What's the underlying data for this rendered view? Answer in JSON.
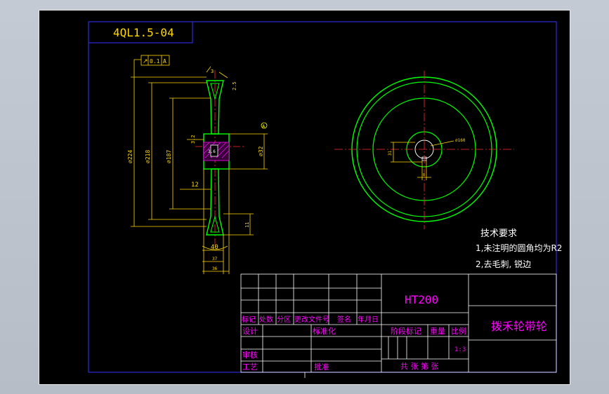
{
  "drawing": {
    "code": "4QL1.5-04",
    "tolerance_frame": {
      "symbol": "↗",
      "value": "0.1",
      "datum": "A"
    },
    "datum_marker": "A",
    "dims": {
      "d224": "⌀224",
      "d218": "⌀218",
      "d187": "⌀187",
      "d32": "⌀32",
      "r05": "3.2",
      "bore": "3.6",
      "angle": "3",
      "chamfer": "2.5",
      "hub_len": "12",
      "groove": "11",
      "w40": "40",
      "w37": "37",
      "w36": "36",
      "front_d": "⌀160",
      "front_h": "31",
      "front_w": "8"
    },
    "notes": {
      "heading": "技术要求",
      "line1": "1,未注明的圆角均为R2",
      "line2": "2,去毛刺, 锐边"
    }
  },
  "title_block": {
    "material": "HT200",
    "part_name": "拨禾轮带轮",
    "hdr_mark": "标记",
    "hdr_count": "处数",
    "hdr_zone": "分区",
    "hdr_doc": "更改文件号",
    "hdr_sign": "签名",
    "hdr_date": "年月日",
    "design": "设计",
    "standard": "标准化",
    "check": "审核",
    "process": "工艺",
    "approve": "批准",
    "stage": "阶段标记",
    "weight": "重量",
    "scale_label": "比例",
    "scale_value": "1:3",
    "sheets": "共  张 第  张"
  },
  "colors": {
    "frame": "#2b2bd6",
    "part": "#00ff00",
    "dimension": "#ffd700",
    "center": "#ff2a2a",
    "note": "#ff00ff",
    "white": "#ffffff",
    "hatch": "#ff00ff",
    "datum": "#ffff00"
  }
}
